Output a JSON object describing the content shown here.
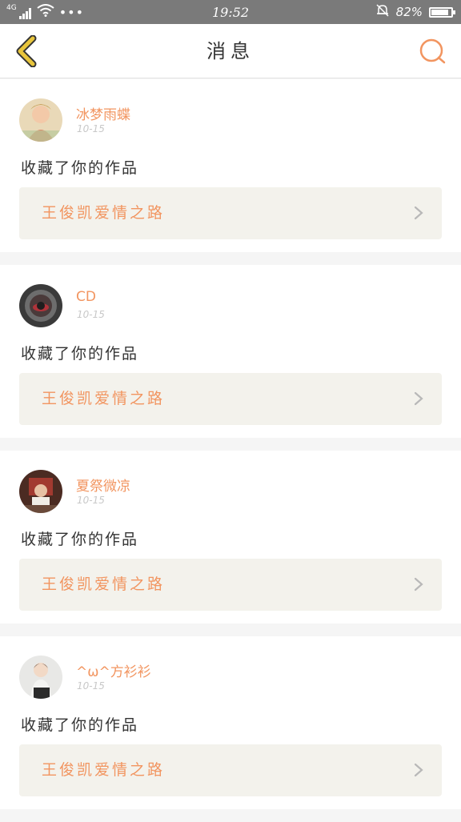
{
  "status_bar": {
    "network": "4G",
    "time": "19:52",
    "battery": "82%",
    "battery_level": 0.82,
    "icons": [
      "signal-icon",
      "wifi-icon",
      "more-dots-icon",
      "silent-bell-icon",
      "battery-icon"
    ]
  },
  "header": {
    "title": "消息",
    "back_icon": "back-chevron-icon",
    "search_icon": "search-icon"
  },
  "colors": {
    "accent": "#f29560",
    "back_icon": "#e0b53a",
    "card_box": "#f3f2ec"
  },
  "messages": [
    {
      "username": "冰梦雨蝶",
      "time": "10-15",
      "action": "收藏了你的作品",
      "work_title": "王俊凯爱情之路"
    },
    {
      "username": "CD",
      "time": "10-15",
      "action": "收藏了你的作品",
      "work_title": "王俊凯爱情之路"
    },
    {
      "username": "夏祭微凉",
      "time": "10-15",
      "action": "收藏了你的作品",
      "work_title": "王俊凯爱情之路"
    },
    {
      "username": "^ω^方衫衫",
      "time": "10-15",
      "action": "收藏了你的作品",
      "work_title": "王俊凯爱情之路"
    }
  ]
}
